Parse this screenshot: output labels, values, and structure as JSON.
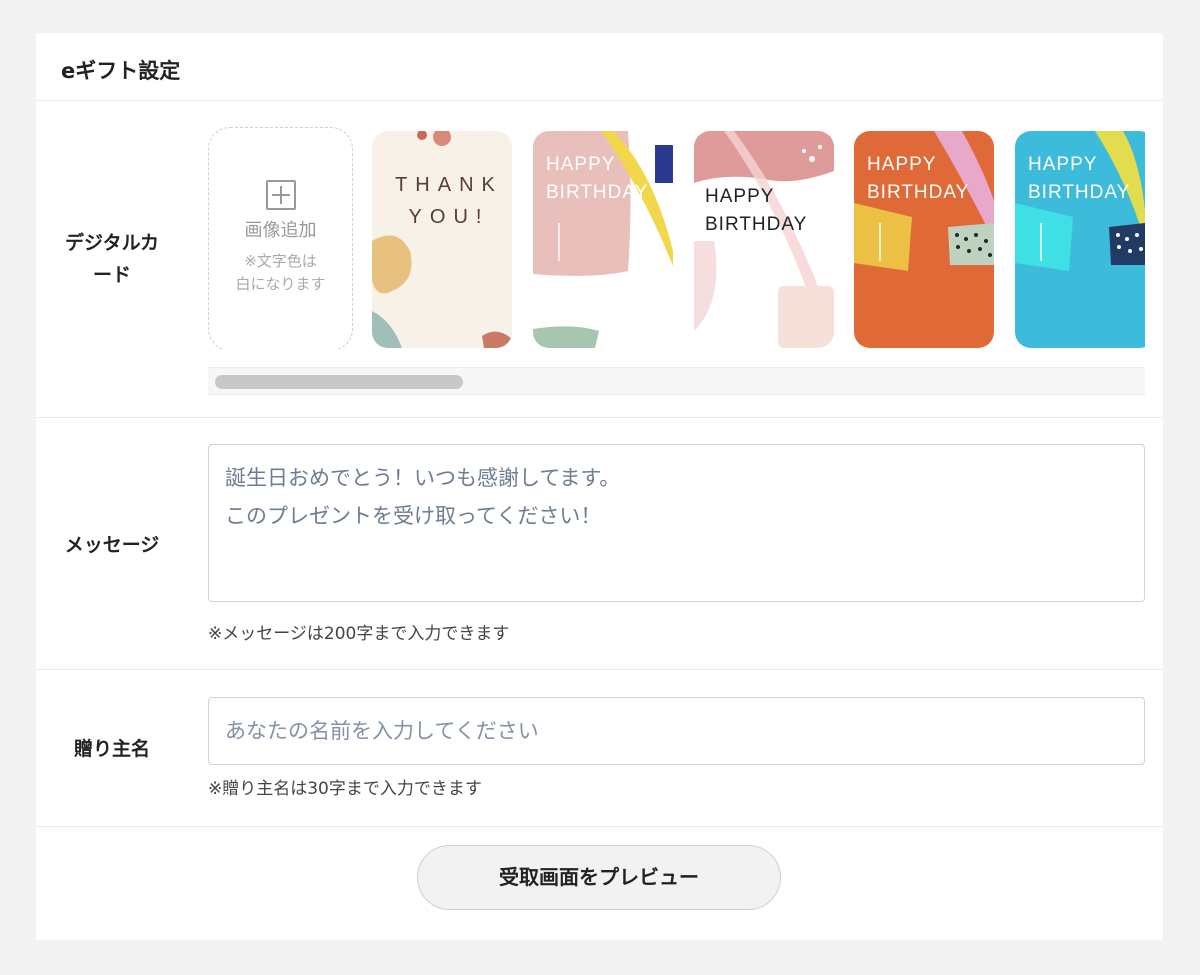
{
  "panel": {
    "title": "eギフト設定"
  },
  "digital_card": {
    "label": "デジタルカード",
    "add_image": {
      "label": "画像追加",
      "note": "※文字色は\n白になります"
    },
    "cards": [
      {
        "name": "thank-you",
        "text": "THANK\nYOU!"
      },
      {
        "name": "happy-birthday-pink",
        "text": "HAPPY\nBIRTHDAY"
      },
      {
        "name": "happy-birthday-white",
        "text": "HAPPY\nBIRTHDAY"
      },
      {
        "name": "happy-birthday-orange",
        "text": "HAPPY\nBIRTHDAY"
      },
      {
        "name": "happy-birthday-blue",
        "text": "HAPPY\nBIRTHDAY"
      }
    ]
  },
  "message": {
    "label": "メッセージ",
    "value": "誕生日おめでとう！いつも感謝してます。\nこのプレゼントを受け取ってください！",
    "hint": "※メッセージは200字まで入力できます"
  },
  "sender": {
    "label": "贈り主名",
    "placeholder": "あなたの名前を入力してください",
    "hint": "※贈り主名は30字まで入力できます"
  },
  "preview_button": {
    "label": "受取画面をプレビュー"
  }
}
